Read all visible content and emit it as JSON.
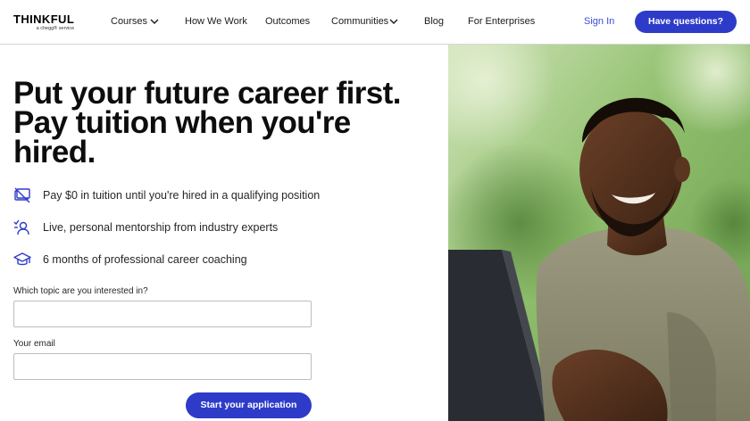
{
  "brand": {
    "name": "THINKFUL",
    "tagline": "a chegg® service"
  },
  "nav": {
    "items": [
      {
        "label": "Courses",
        "has_dropdown": true
      },
      {
        "label": "How We Work",
        "has_dropdown": false
      },
      {
        "label": "Outcomes",
        "has_dropdown": false
      },
      {
        "label": "Communities",
        "has_dropdown": true
      },
      {
        "label": "Blog",
        "has_dropdown": false
      },
      {
        "label": "For Enterprises",
        "has_dropdown": false
      }
    ],
    "sign_in": "Sign In",
    "cta": "Have questions?"
  },
  "hero": {
    "headline_line1": "Put your future career first.",
    "headline_line2": "Pay tuition when you're",
    "headline_line3": "hired.",
    "benefits": [
      {
        "icon": "tuition-card-icon",
        "text": "Pay $0 in tuition until you're hired in a qualifying position"
      },
      {
        "icon": "mentorship-icon",
        "text": "Live, personal mentorship from industry experts"
      },
      {
        "icon": "graduation-cap-icon",
        "text": "6 months of professional career coaching"
      }
    ],
    "photo": "smiling-student-with-laptop"
  },
  "form": {
    "topic_label": "Which topic are you interested in?",
    "topic_value": "",
    "email_label": "Your email",
    "email_value": "",
    "submit": "Start your application"
  },
  "colors": {
    "accent": "#2e3bc9",
    "link": "#3d4bd8",
    "text": "#0d0d0d"
  }
}
